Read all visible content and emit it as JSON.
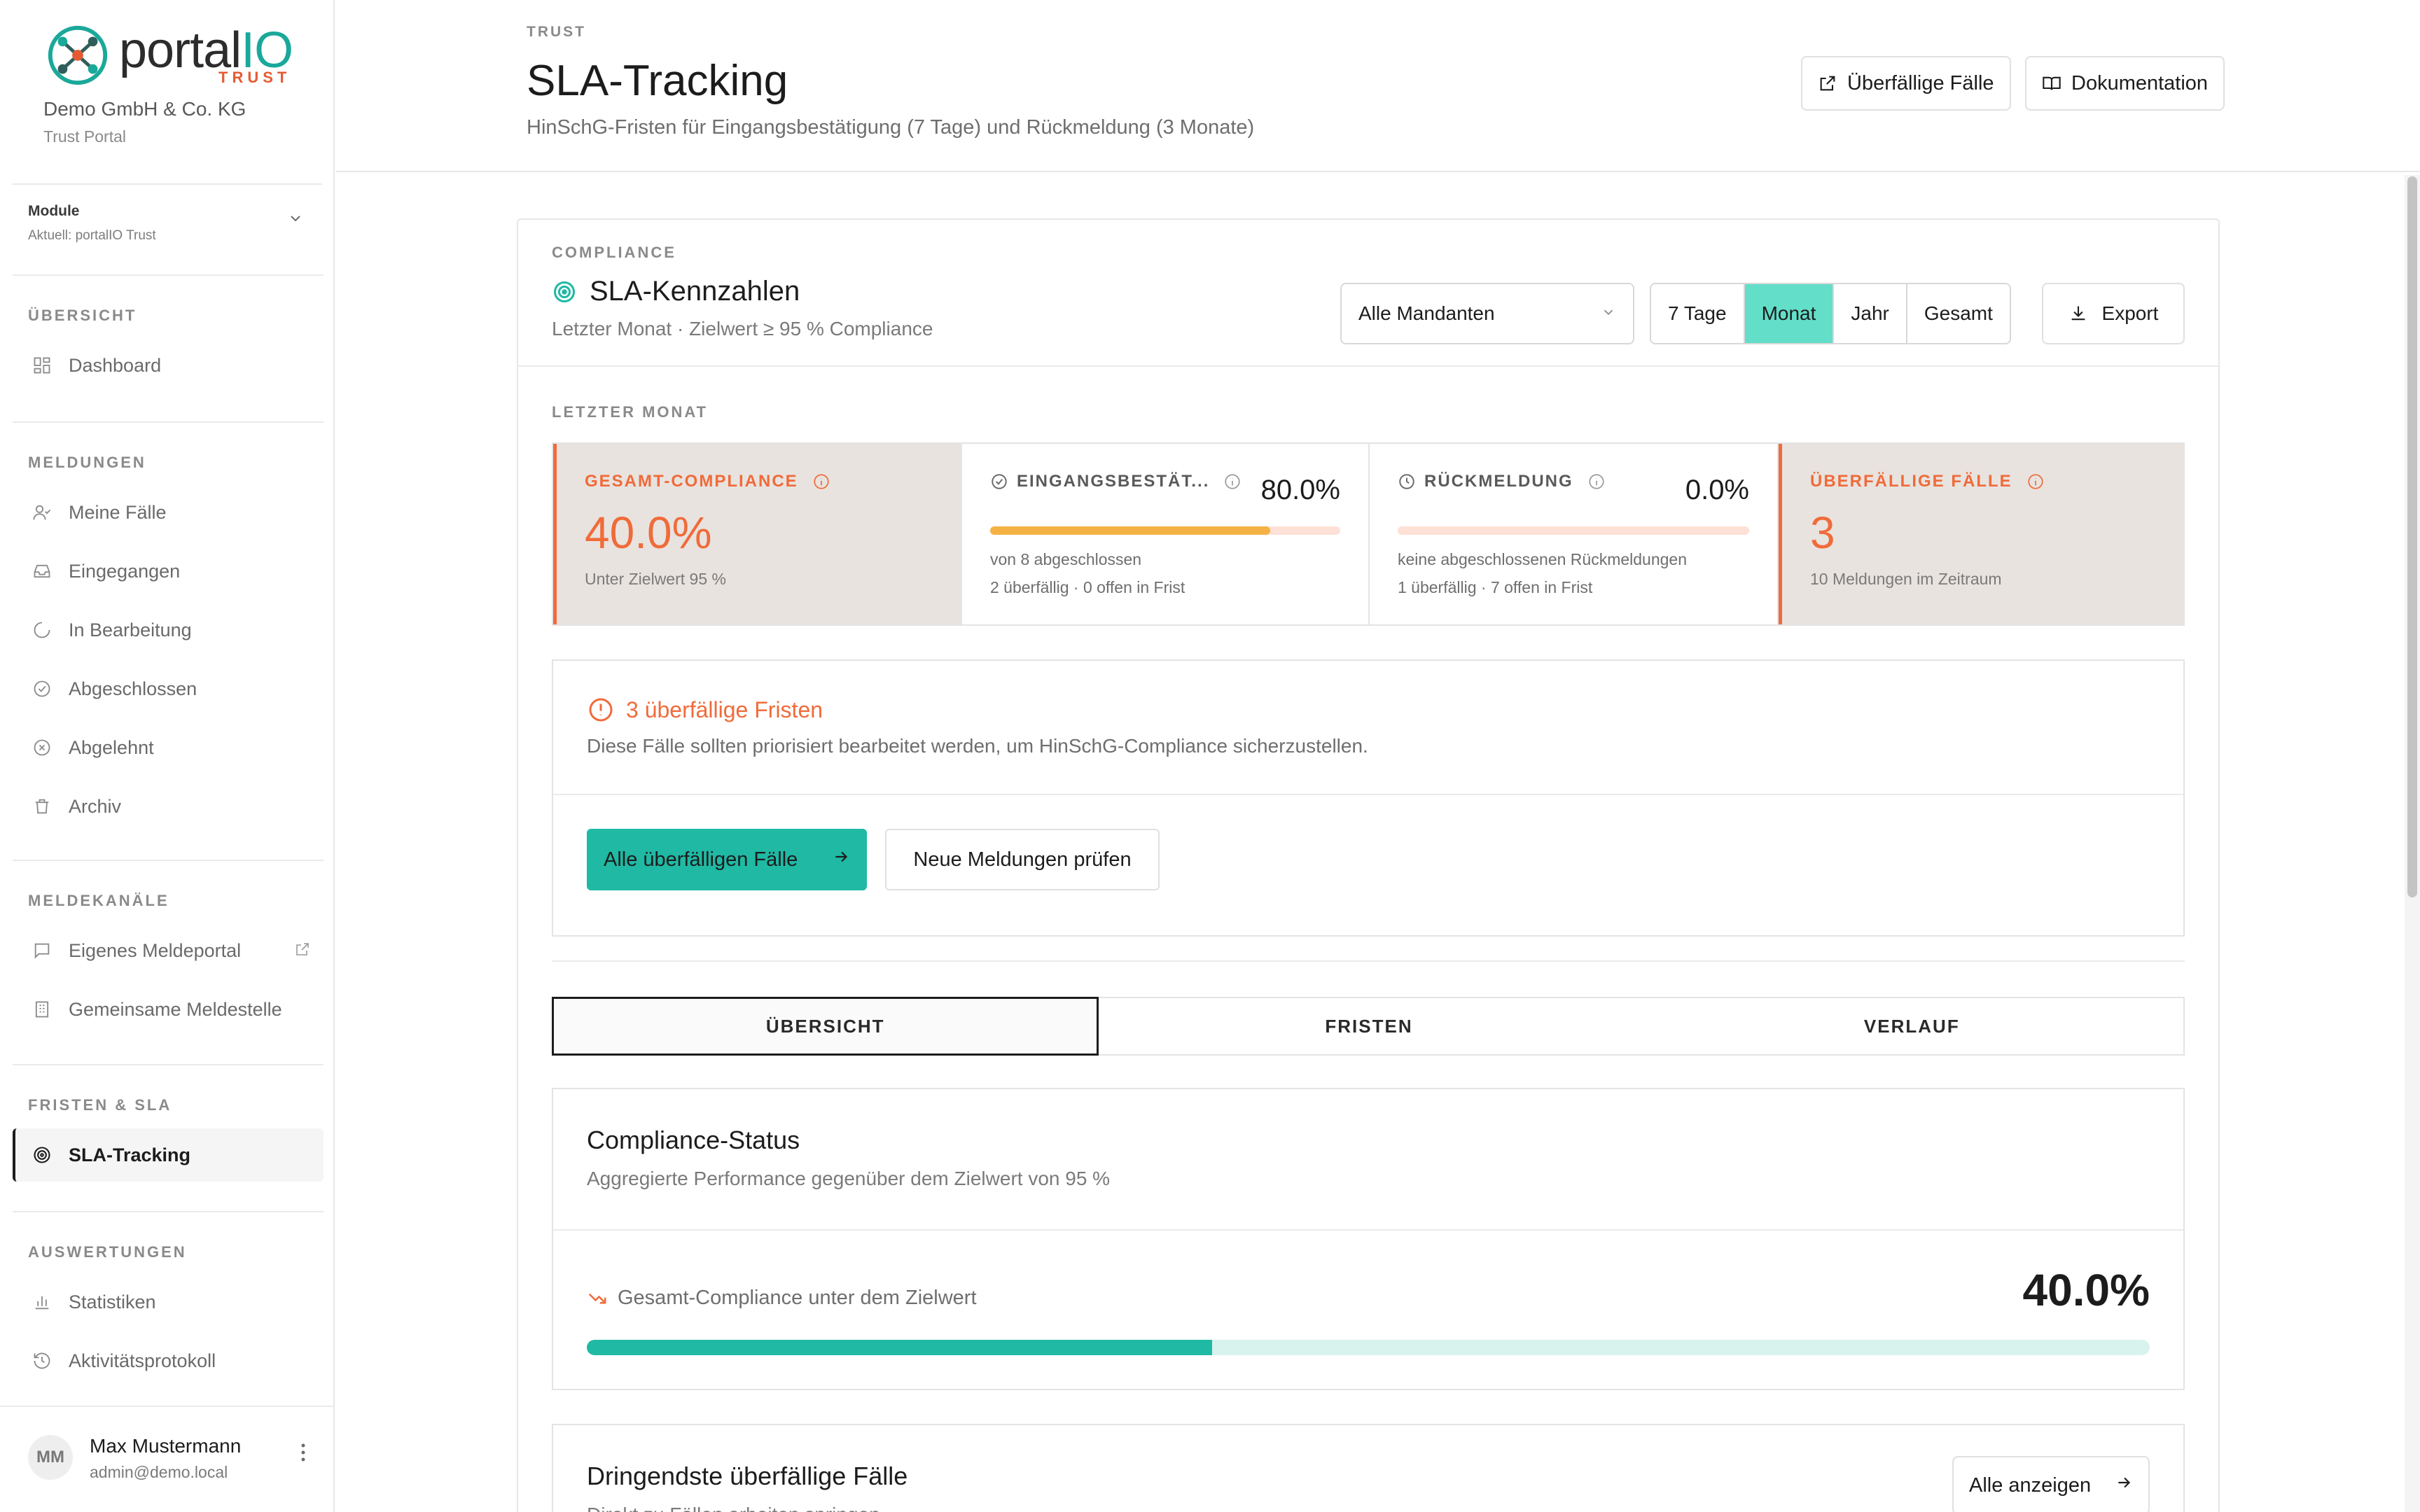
{
  "brand": {
    "name_main": "portal",
    "name_accent": "IO",
    "sub": "TRUST",
    "accent_color": "#1aa89a",
    "sub_color": "#e45b33"
  },
  "org": {
    "name": "Demo GmbH & Co. KG",
    "portal": "Trust Portal"
  },
  "module": {
    "label": "Module",
    "current": "Aktuell: portalIO Trust"
  },
  "sidebar": {
    "sections": [
      {
        "title": "ÜBERSICHT",
        "items": [
          {
            "label": "Dashboard",
            "icon": "grid-icon"
          }
        ]
      },
      {
        "title": "MELDUNGEN",
        "items": [
          {
            "label": "Meine Fälle",
            "icon": "user-check-icon"
          },
          {
            "label": "Eingegangen",
            "icon": "inbox-icon"
          },
          {
            "label": "In Bearbeitung",
            "icon": "loader-icon"
          },
          {
            "label": "Abgeschlossen",
            "icon": "check-circle-icon"
          },
          {
            "label": "Abgelehnt",
            "icon": "x-circle-icon"
          },
          {
            "label": "Archiv",
            "icon": "trash-icon"
          }
        ]
      },
      {
        "title": "MELDEKANÄLE",
        "items": [
          {
            "label": "Eigenes Meldeportal",
            "icon": "message-square-icon"
          },
          {
            "label": "Gemeinsame Meldestelle",
            "icon": "building-icon"
          }
        ]
      },
      {
        "title": "FRISTEN & SLA",
        "items": [
          {
            "label": "SLA-Tracking",
            "icon": "target-icon",
            "active": true
          }
        ]
      },
      {
        "title": "AUSWERTUNGEN",
        "items": [
          {
            "label": "Statistiken",
            "icon": "bar-chart-icon"
          },
          {
            "label": "Aktivitätsprotokoll",
            "icon": "history-icon"
          }
        ]
      }
    ]
  },
  "user": {
    "initials": "MM",
    "name": "Max Mustermann",
    "email": "admin@demo.local"
  },
  "header": {
    "eyebrow": "TRUST",
    "title": "SLA-Tracking",
    "subtitle": "HinSchG-Fristen für Eingangsbestätigung (7 Tage) und Rückmeldung (3 Monate)",
    "btn_overdue": "Überfällige Fälle",
    "btn_docs": "Dokumentation"
  },
  "card": {
    "eyebrow": "COMPLIANCE",
    "title": "SLA-Kennzahlen",
    "subtitle": "Letzter Monat · Zielwert ≥ 95 % Compliance",
    "select_value": "Alle Mandanten",
    "periods": [
      "7 Tage",
      "Monat",
      "Jahr",
      "Gesamt"
    ],
    "active_period": "Monat",
    "export_label": "Export",
    "period_label": "LETZTER MONAT"
  },
  "kpis": {
    "compliance": {
      "label": "GESAMT-COMPLIANCE",
      "value": "40.0%",
      "note": "Unter Zielwert 95 %"
    },
    "receipt": {
      "label": "EINGANGSBESTÄT...",
      "value": "80.0%",
      "progress": 0.8,
      "line1": "von 8 abgeschlossen",
      "line2": "2 überfällig · 0 offen in Frist"
    },
    "feedback": {
      "label": "RÜCKMELDUNG",
      "value": "0.0%",
      "progress": 0.0,
      "line1": "keine abgeschlossenen Rückmeldungen",
      "line2": "1 überfällig · 7 offen in Frist"
    },
    "overdue": {
      "label": "ÜBERFÄLLIGE FÄLLE",
      "value": "3",
      "note": "10 Meldungen im Zeitraum"
    }
  },
  "alert": {
    "title": "3 überfällige Fristen",
    "text": "Diese Fälle sollten priorisiert bearbeitet werden, um HinSchG-Compliance sicherzustellen.",
    "primary_btn": "Alle überfälligen Fälle",
    "secondary_btn": "Neue Meldungen prüfen"
  },
  "tabs": [
    "ÜBERSICHT",
    "FRISTEN",
    "VERLAUF"
  ],
  "status": {
    "title": "Compliance-Status",
    "subtitle": "Aggregierte Performance gegenüber dem Zielwert von 95 %",
    "trend": "Gesamt-Compliance unter dem Zielwert",
    "value": "40.0%",
    "progress": 0.4
  },
  "urgent": {
    "title": "Dringendste überfällige Fälle",
    "subtitle": "Direkt zu Fällen arbeiten springen",
    "btn": "Alle anzeigen"
  },
  "colors": {
    "accent": "#1fb9a4",
    "alert": "#f06b3a",
    "segment_active": "#62dec9",
    "progress_warn": "#f5b244"
  }
}
